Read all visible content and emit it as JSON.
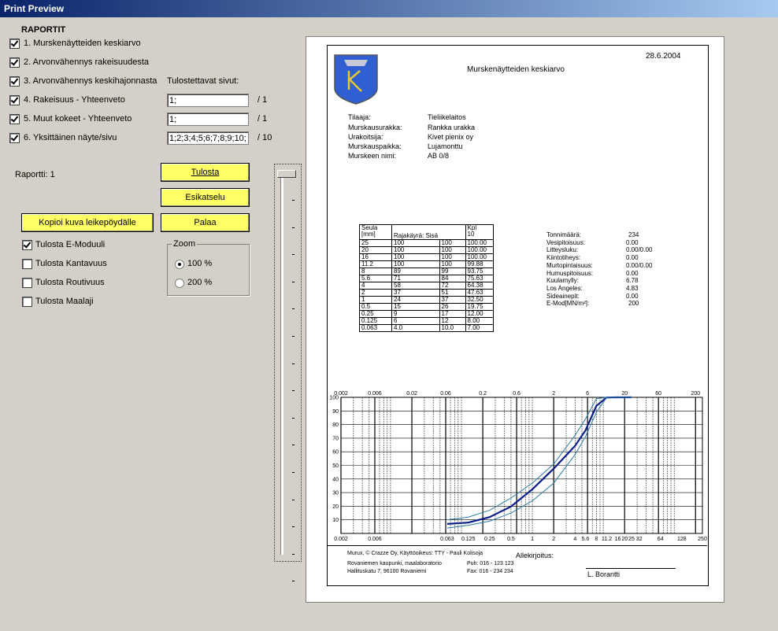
{
  "window": {
    "title": "Print Preview"
  },
  "reports": {
    "heading": "RAPORTIT",
    "items": [
      {
        "label": "1. Murskenäytteiden keskiarvo",
        "checked": true
      },
      {
        "label": "2. Arvonvähennys rakeisuudesta",
        "checked": true
      },
      {
        "label": "3. Arvonvähennys keskihajonnasta",
        "checked": true
      },
      {
        "label": "4. Rakeisuus - Yhteenveto",
        "checked": true
      },
      {
        "label": "5. Muut kokeet - Yhteenveto",
        "checked": true
      },
      {
        "label": "6. Yksittäinen näyte/sivu",
        "checked": true
      }
    ],
    "pages_label": "Tulostettavat sivut:",
    "page_fields": [
      {
        "value": "1;",
        "total": "/ 1"
      },
      {
        "value": "1;",
        "total": "/ 1"
      },
      {
        "value": "1;2;3;4;5;6;7;8;9;10;",
        "total": "/ 10"
      }
    ]
  },
  "status": {
    "report_label": "Raportti: 1"
  },
  "buttons": {
    "print": "Tulosta",
    "preview": "Esikatselu",
    "copy": "Kopioi  kuva leikepöydälle",
    "back": "Palaa"
  },
  "options": [
    {
      "label": "Tulosta E-Moduuli",
      "checked": true
    },
    {
      "label": "Tulosta Kantavuus",
      "checked": false
    },
    {
      "label": "Tulosta Routivuus",
      "checked": false
    },
    {
      "label": "Tulosta Maalaji",
      "checked": false
    }
  ],
  "zoom": {
    "label": "Zoom",
    "options": [
      {
        "label": "100 %",
        "selected": true
      },
      {
        "label": "200 %",
        "selected": false
      }
    ]
  },
  "page": {
    "date": "28.6.2004",
    "title": "Murskenäytteiden keskiarvo",
    "info": [
      {
        "key": "Tilaaja:",
        "value": "Tieliikelaitos"
      },
      {
        "key": "Murskausurakka:",
        "value": "Rankka urakka"
      },
      {
        "key": "Urakoitsija:",
        "value": "Kivet pienix oy"
      },
      {
        "key": "Murskauspaikka:",
        "value": "Lujamonttu"
      },
      {
        "key": "Murskeen nimi:",
        "value": "AB 0/8"
      }
    ],
    "sieve_table": {
      "header": [
        [
          "Seula",
          "[mm]"
        ],
        [
          "Rajakäyrä: Sisä"
        ],
        [
          ""
        ],
        [
          "Kpl",
          "10"
        ]
      ],
      "rows": [
        [
          "25",
          "100",
          "100",
          "100.00"
        ],
        [
          "20",
          "100",
          "100",
          "100.00"
        ],
        [
          "16",
          "100",
          "100",
          "100.00"
        ],
        [
          "11.2",
          "100",
          "100",
          "99.88"
        ],
        [
          "8",
          "89",
          "99",
          "93.75"
        ],
        [
          "5.6",
          "71",
          "84",
          "75.63"
        ],
        [
          "4",
          "58",
          "72",
          "64.38"
        ],
        [
          "2",
          "37",
          "51",
          "47.63"
        ],
        [
          "1",
          "24",
          "37",
          "32.50"
        ],
        [
          "0.5",
          "15",
          "26",
          "19.75"
        ],
        [
          "0.25",
          "9",
          "17",
          "12.00"
        ],
        [
          "0.125",
          "6",
          "12",
          "8.00"
        ],
        [
          "0.063",
          "4.0",
          "10.0",
          "7.00"
        ]
      ]
    },
    "properties": [
      {
        "key": "Tonnimäärä:",
        "value": "234"
      },
      {
        "key": "Vesipitoisuus:",
        "value": "0.00"
      },
      {
        "key": "Litteysluku:",
        "value": "0.00/0.00"
      },
      {
        "key": "Kiintotiheys:",
        "value": "0.00"
      },
      {
        "key": "Murtopintaisuus:",
        "value": "0.00/0.00"
      },
      {
        "key": "Humuspitoisuus:",
        "value": "0.00"
      },
      {
        "key": "Kuulamylly:",
        "value": "6.78"
      },
      {
        "key": "Los Angeles:",
        "value": "4.83"
      },
      {
        "key": "Sideainepit:",
        "value": "0.00"
      },
      {
        "key": "E-Mod[MN/m²]:",
        "value": "200"
      }
    ],
    "footer": {
      "line1": "Murux, © Crazze Oy, Käyttöoikeus: TTY - Pauli Kolisoja",
      "line2": "Rovaniemen kaupunki, maalaboratorio",
      "line3": "Hallituskatu 7, 96100 Rovaniemi",
      "phone": "Puh: 016 - 123 123",
      "fax": "Fax: 016 - 234 234",
      "sign_label": "Allekirjoitus:",
      "signer": "L. Borantti"
    }
  },
  "chart_data": {
    "type": "line",
    "xscale": "log",
    "top_ticks": [
      "0.002",
      "0.006",
      "0.02",
      "0.06",
      "0.2",
      "0.6",
      "2",
      "6",
      "20",
      "60",
      "200"
    ],
    "bottom_ticks": [
      "0.002",
      "0.006",
      "0.063",
      "0.125",
      "0.25",
      "0.5",
      "1",
      "2",
      "4",
      "5.6",
      "8",
      "11.2",
      "16",
      "20",
      "25",
      "32",
      "64",
      "128",
      "250"
    ],
    "y_ticks": [
      "100",
      "90",
      "80",
      "70",
      "60",
      "50",
      "40",
      "30",
      "20",
      "10"
    ],
    "ylim": [
      0,
      100
    ],
    "xlim": [
      0.002,
      250
    ],
    "series": [
      {
        "x": [
          0.063,
          0.125,
          0.25,
          0.5,
          1,
          2,
          4,
          5.6,
          8,
          11.2,
          16,
          20,
          25
        ],
        "y": [
          7.0,
          8.0,
          12.0,
          19.75,
          32.5,
          47.63,
          64.38,
          75.63,
          93.75,
          99.88,
          100,
          100,
          100
        ]
      },
      {
        "x": [
          0.063,
          0.125,
          0.25,
          0.5,
          1,
          2,
          4,
          5.6,
          8,
          11.2,
          16,
          20,
          25
        ],
        "y": [
          4.0,
          6,
          9,
          15,
          24,
          37,
          58,
          71,
          89,
          100,
          100,
          100,
          100
        ]
      },
      {
        "x": [
          0.063,
          0.125,
          0.25,
          0.5,
          1,
          2,
          4,
          5.6,
          8,
          11.2,
          16,
          20,
          25
        ],
        "y": [
          10.0,
          12,
          17,
          26,
          37,
          51,
          72,
          84,
          99,
          100,
          100,
          100,
          100
        ]
      }
    ]
  }
}
